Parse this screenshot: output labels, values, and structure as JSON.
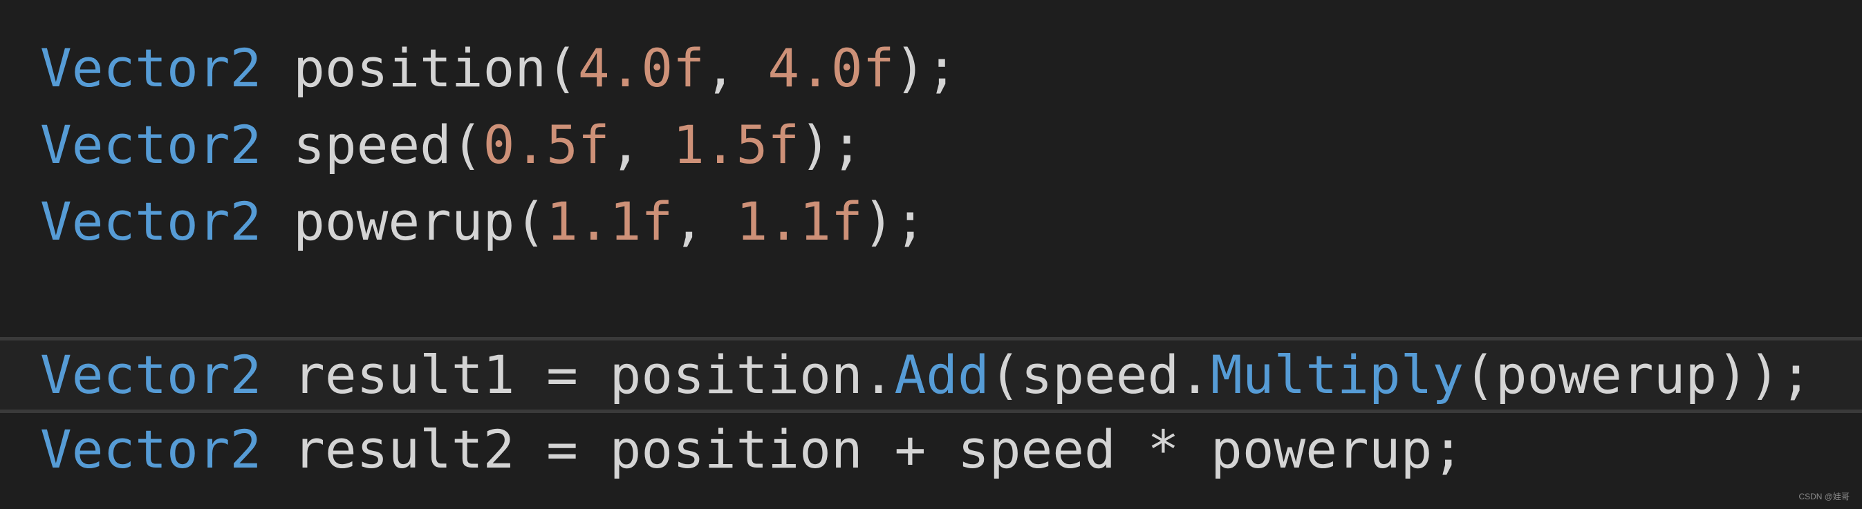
{
  "code": {
    "lines": [
      {
        "type": "Vector2",
        "name": "position",
        "open": "(",
        "arg1": "4.0f",
        "sep": ", ",
        "arg2": "4.0f",
        "close": ");"
      },
      {
        "type": "Vector2",
        "name": "speed",
        "open": "(",
        "arg1": "0.5f",
        "sep": ", ",
        "arg2": "1.5f",
        "close": ");"
      },
      {
        "type": "Vector2",
        "name": "powerup",
        "open": "(",
        "arg1": "1.1f",
        "sep": ", ",
        "arg2": "1.1f",
        "close": ");"
      },
      {
        "type": "Vector2",
        "name": "result1",
        "eq": " = ",
        "obj": "position",
        "dot": ".",
        "method": "Add",
        "open": "(",
        "arg_obj": "speed",
        "dot2": ".",
        "method2": "Multiply",
        "open2": "(",
        "arg": "powerup",
        "close": "));"
      },
      {
        "type": "Vector2",
        "name": "result2",
        "eq": " = ",
        "a": "position",
        "plus": " + ",
        "b": "speed",
        "times": " * ",
        "c": "powerup",
        "semi": ";"
      }
    ],
    "colors": {
      "background": "#1e1e1e",
      "type": "#569cd6",
      "identifier": "#d4d4d4",
      "number": "#ce9178",
      "method": "#569cd6",
      "current_line_border": "#3a3a3a"
    }
  },
  "watermark": "CSDN @娃哥"
}
